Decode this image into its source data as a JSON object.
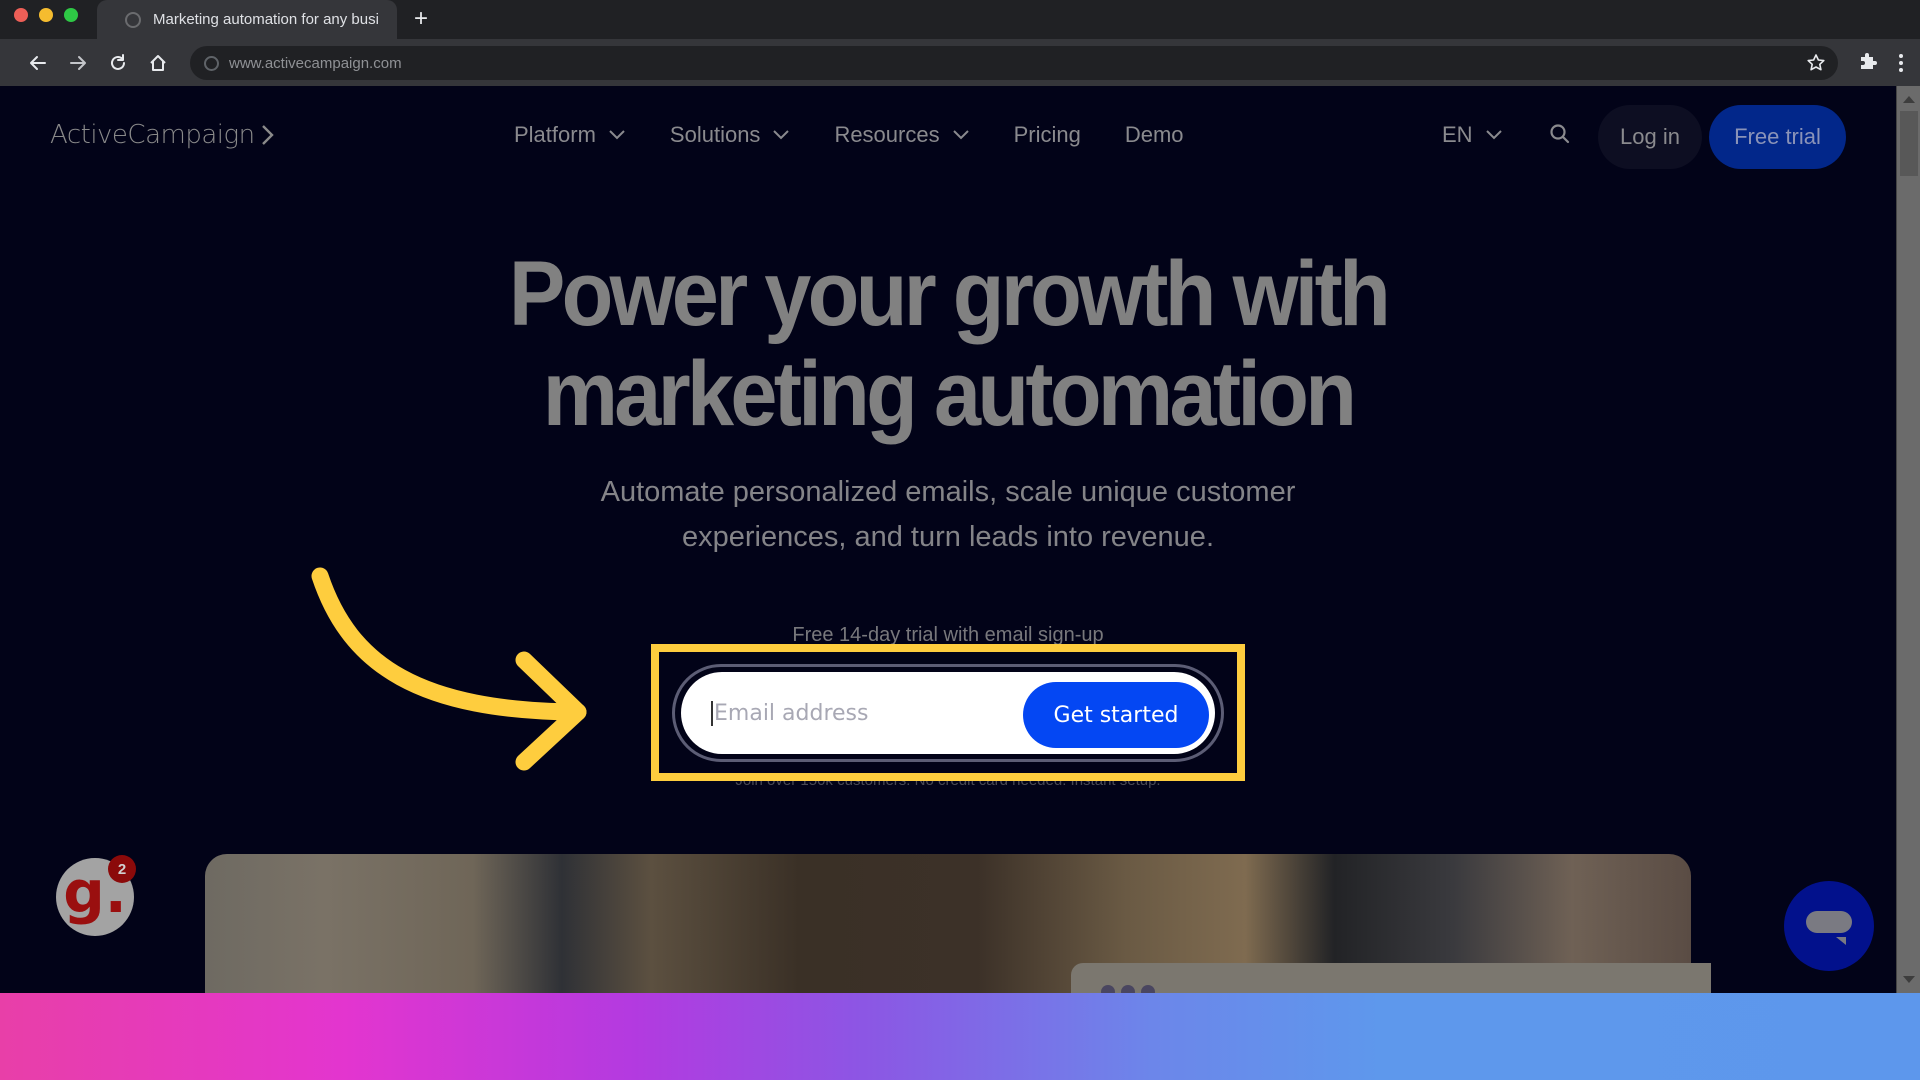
{
  "browser": {
    "tab_title": "Marketing automation for any busi",
    "new_tab_label": "+",
    "url": "www.activecampaign.com",
    "icons": {
      "back": "arrow-left-icon",
      "forward": "arrow-right-icon",
      "reload": "reload-icon",
      "home": "home-icon",
      "site_info": "globe-icon",
      "bookmark": "star-icon",
      "extensions": "puzzle-icon",
      "menu": "kebab-menu-icon"
    }
  },
  "site": {
    "logo": "ActiveCampaign",
    "nav": [
      {
        "label": "Platform",
        "has_dropdown": true
      },
      {
        "label": "Solutions",
        "has_dropdown": true
      },
      {
        "label": "Resources",
        "has_dropdown": true
      },
      {
        "label": "Pricing",
        "has_dropdown": false
      },
      {
        "label": "Demo",
        "has_dropdown": false
      }
    ],
    "language": "EN",
    "login_label": "Log in",
    "free_trial_label": "Free trial"
  },
  "hero": {
    "title_line1": "Power your growth with",
    "title_line2": "marketing automation",
    "subtitle_line1": "Automate personalized emails, scale unique customer",
    "subtitle_line2": "experiences, and turn leads into revenue.",
    "trial_label": "Free 14-day trial with email sign-up",
    "email_placeholder": "Email address",
    "email_value": "",
    "cta_label": "Get started",
    "join_label": "Join over 150k customers. No credit card needed. Instant setup."
  },
  "widgets": {
    "g_badge_letter": "g.",
    "g_badge_count": "2",
    "chat_icon": "chat-bubble-icon"
  },
  "annotation": {
    "highlight_color": "#fecd3e",
    "arrow_color": "#fecd3e"
  },
  "colors": {
    "page_bg": "#020318",
    "cta_blue": "#0447f3",
    "free_trial_bg": "#02278a",
    "chat_bg": "#02118c"
  }
}
